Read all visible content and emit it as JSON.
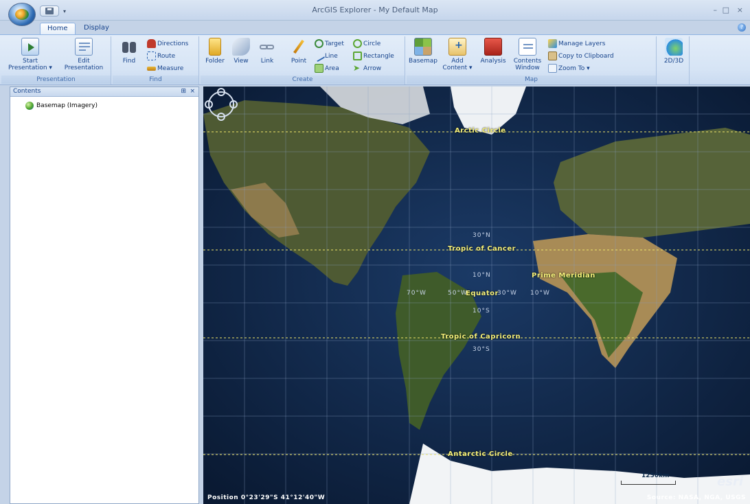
{
  "window": {
    "title": "ArcGIS Explorer - My Default Map",
    "controls": [
      "–",
      "□",
      "×"
    ]
  },
  "ribbon": {
    "tabs": [
      "Home",
      "Display"
    ],
    "groups": {
      "presentation": {
        "label": "Presentation",
        "start": "Start\nPresentation ▾",
        "edit": "Edit\nPresentation"
      },
      "find": {
        "label": "Find",
        "find": "Find",
        "directions": "Directions",
        "route": "Route",
        "measure": "Measure"
      },
      "create": {
        "label": "Create",
        "folder": "Folder",
        "view": "View",
        "link": "Link",
        "point": "Point",
        "target": "Target",
        "line": "Line",
        "area": "Area",
        "circle": "Circle",
        "rectangle": "Rectangle",
        "arrow": "Arrow"
      },
      "map": {
        "label": "Map",
        "basemap": "Basemap",
        "add_content": "Add\nContent ▾",
        "analysis": "Analysis",
        "contents_window": "Contents\nWindow",
        "manage_layers": "Manage Layers",
        "copy_clipboard": "Copy to Clipboard",
        "zoom_to": "Zoom To ▾",
        "view_2d3d": "2D/3D"
      }
    }
  },
  "contents_panel": {
    "title": "Contents",
    "pin": "⊞",
    "close": "×",
    "layers": [
      "Basemap (Imagery)"
    ]
  },
  "map": {
    "labels": {
      "arctic_circle": "Arctic Circle",
      "tropic_cancer": "Tropic of Cancer",
      "prime_meridian": "Prime Meridian",
      "equator": "Equator",
      "tropic_capricorn": "Tropic of Capricorn",
      "antarctic_circle": "Antarctic Circle"
    },
    "grid": {
      "lat30n": "30°N",
      "lat10n": "10°N",
      "lat10s": "10°S",
      "lat30s": "30°S",
      "lon70w": "70°W",
      "lon50w": "50°W",
      "lon30w": "30°W",
      "lon10w": "10°W"
    },
    "position": "Position 0°23'29\"S 41°12'40\"W",
    "source": "Source: NASA, NGA, USGS",
    "scale": "1250km",
    "logo": "esri"
  },
  "colors": {
    "ocean": "#0d2342",
    "land": "#5f6b3a",
    "ice": "#f0f2f4",
    "desert": "#b79a65",
    "line_label": "#f5f07a"
  }
}
